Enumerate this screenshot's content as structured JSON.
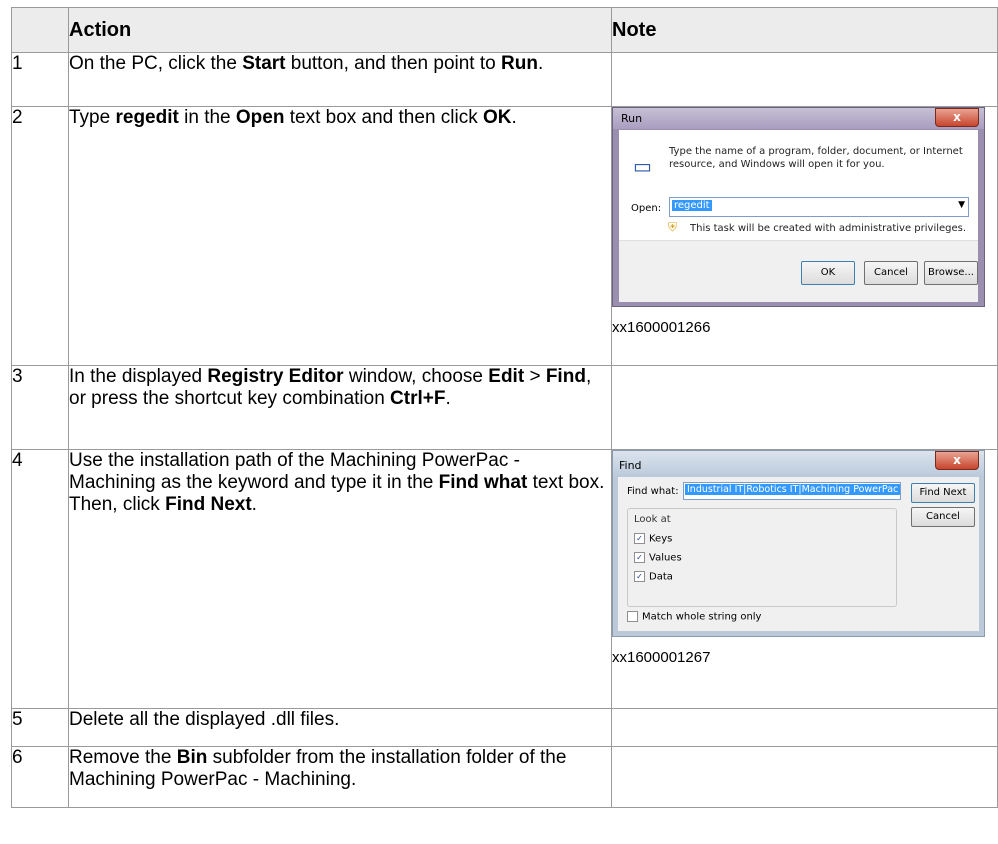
{
  "table": {
    "headers": [
      "",
      "Action",
      "Note"
    ],
    "rows": [
      {
        "num": "1"
      },
      {
        "num": "2",
        "image_id": "xx1600001266"
      },
      {
        "num": "3"
      },
      {
        "num": "4",
        "image_id": "xx1600001267"
      },
      {
        "num": "5",
        "action": "Delete all the displayed .dll files."
      },
      {
        "num": "6"
      }
    ]
  },
  "steps": {
    "s1": {
      "a": "On the PC, click the ",
      "b": "Start",
      "c": " button, and then point to ",
      "d": "Run",
      "e": "."
    },
    "s2": {
      "a": "Type ",
      "b": "regedit",
      "c": " in the ",
      "d": "Open",
      "e": " text box and then click ",
      "f": "OK",
      "g": "."
    },
    "s3": {
      "a": "In the displayed ",
      "b": "Registry Editor",
      "c": " window, choose ",
      "d": "Edit",
      "e": " > ",
      "f": "Find",
      "g": ", or press the shortcut key combination ",
      "h": "Ctrl+F",
      "i": "."
    },
    "s4": {
      "a": "Use the installation path of the Machining PowerPac - Machining as the keyword and type it in the ",
      "b": "Find what",
      "c": " text box. Then, click ",
      "d": "Find Next",
      "e": "."
    },
    "s6": {
      "a": "Remove the ",
      "b": "Bin",
      "c": " subfolder from the installation folder of the Machining PowerPac - Machining."
    }
  },
  "run_dialog": {
    "title": "Run",
    "close": "x",
    "message": "Type the name of a program, folder, document, or Internet resource, and Windows will open it for you.",
    "open_label": "Open:",
    "open_value": "regedit",
    "admin_note": "This task will be created with administrative privileges.",
    "ok": "OK",
    "cancel": "Cancel",
    "browse": "Browse..."
  },
  "find_dialog": {
    "title": "Find",
    "close": "x",
    "find_what_label": "Find what:",
    "find_what_value": "Industrial IT|Robotics IT|Machining PowerPac",
    "find_next": "Find Next",
    "cancel": "Cancel",
    "look_at": "Look at",
    "keys": "Keys",
    "values": "Values",
    "data": "Data",
    "match_whole": "Match whole string only"
  }
}
